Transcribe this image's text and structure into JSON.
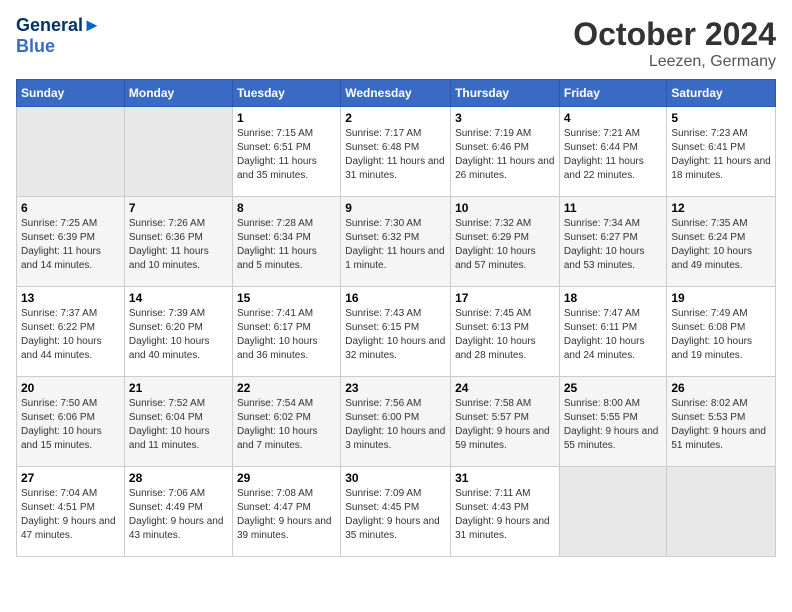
{
  "header": {
    "logo_line1": "General",
    "logo_line2": "Blue",
    "month_title": "October 2024",
    "subtitle": "Leezen, Germany"
  },
  "weekdays": [
    "Sunday",
    "Monday",
    "Tuesday",
    "Wednesday",
    "Thursday",
    "Friday",
    "Saturday"
  ],
  "weeks": [
    [
      {
        "day": "",
        "info": ""
      },
      {
        "day": "",
        "info": ""
      },
      {
        "day": "1",
        "info": "Sunrise: 7:15 AM\nSunset: 6:51 PM\nDaylight: 11 hours and 35 minutes."
      },
      {
        "day": "2",
        "info": "Sunrise: 7:17 AM\nSunset: 6:48 PM\nDaylight: 11 hours and 31 minutes."
      },
      {
        "day": "3",
        "info": "Sunrise: 7:19 AM\nSunset: 6:46 PM\nDaylight: 11 hours and 26 minutes."
      },
      {
        "day": "4",
        "info": "Sunrise: 7:21 AM\nSunset: 6:44 PM\nDaylight: 11 hours and 22 minutes."
      },
      {
        "day": "5",
        "info": "Sunrise: 7:23 AM\nSunset: 6:41 PM\nDaylight: 11 hours and 18 minutes."
      }
    ],
    [
      {
        "day": "6",
        "info": "Sunrise: 7:25 AM\nSunset: 6:39 PM\nDaylight: 11 hours and 14 minutes."
      },
      {
        "day": "7",
        "info": "Sunrise: 7:26 AM\nSunset: 6:36 PM\nDaylight: 11 hours and 10 minutes."
      },
      {
        "day": "8",
        "info": "Sunrise: 7:28 AM\nSunset: 6:34 PM\nDaylight: 11 hours and 5 minutes."
      },
      {
        "day": "9",
        "info": "Sunrise: 7:30 AM\nSunset: 6:32 PM\nDaylight: 11 hours and 1 minute."
      },
      {
        "day": "10",
        "info": "Sunrise: 7:32 AM\nSunset: 6:29 PM\nDaylight: 10 hours and 57 minutes."
      },
      {
        "day": "11",
        "info": "Sunrise: 7:34 AM\nSunset: 6:27 PM\nDaylight: 10 hours and 53 minutes."
      },
      {
        "day": "12",
        "info": "Sunrise: 7:35 AM\nSunset: 6:24 PM\nDaylight: 10 hours and 49 minutes."
      }
    ],
    [
      {
        "day": "13",
        "info": "Sunrise: 7:37 AM\nSunset: 6:22 PM\nDaylight: 10 hours and 44 minutes."
      },
      {
        "day": "14",
        "info": "Sunrise: 7:39 AM\nSunset: 6:20 PM\nDaylight: 10 hours and 40 minutes."
      },
      {
        "day": "15",
        "info": "Sunrise: 7:41 AM\nSunset: 6:17 PM\nDaylight: 10 hours and 36 minutes."
      },
      {
        "day": "16",
        "info": "Sunrise: 7:43 AM\nSunset: 6:15 PM\nDaylight: 10 hours and 32 minutes."
      },
      {
        "day": "17",
        "info": "Sunrise: 7:45 AM\nSunset: 6:13 PM\nDaylight: 10 hours and 28 minutes."
      },
      {
        "day": "18",
        "info": "Sunrise: 7:47 AM\nSunset: 6:11 PM\nDaylight: 10 hours and 24 minutes."
      },
      {
        "day": "19",
        "info": "Sunrise: 7:49 AM\nSunset: 6:08 PM\nDaylight: 10 hours and 19 minutes."
      }
    ],
    [
      {
        "day": "20",
        "info": "Sunrise: 7:50 AM\nSunset: 6:06 PM\nDaylight: 10 hours and 15 minutes."
      },
      {
        "day": "21",
        "info": "Sunrise: 7:52 AM\nSunset: 6:04 PM\nDaylight: 10 hours and 11 minutes."
      },
      {
        "day": "22",
        "info": "Sunrise: 7:54 AM\nSunset: 6:02 PM\nDaylight: 10 hours and 7 minutes."
      },
      {
        "day": "23",
        "info": "Sunrise: 7:56 AM\nSunset: 6:00 PM\nDaylight: 10 hours and 3 minutes."
      },
      {
        "day": "24",
        "info": "Sunrise: 7:58 AM\nSunset: 5:57 PM\nDaylight: 9 hours and 59 minutes."
      },
      {
        "day": "25",
        "info": "Sunrise: 8:00 AM\nSunset: 5:55 PM\nDaylight: 9 hours and 55 minutes."
      },
      {
        "day": "26",
        "info": "Sunrise: 8:02 AM\nSunset: 5:53 PM\nDaylight: 9 hours and 51 minutes."
      }
    ],
    [
      {
        "day": "27",
        "info": "Sunrise: 7:04 AM\nSunset: 4:51 PM\nDaylight: 9 hours and 47 minutes."
      },
      {
        "day": "28",
        "info": "Sunrise: 7:06 AM\nSunset: 4:49 PM\nDaylight: 9 hours and 43 minutes."
      },
      {
        "day": "29",
        "info": "Sunrise: 7:08 AM\nSunset: 4:47 PM\nDaylight: 9 hours and 39 minutes."
      },
      {
        "day": "30",
        "info": "Sunrise: 7:09 AM\nSunset: 4:45 PM\nDaylight: 9 hours and 35 minutes."
      },
      {
        "day": "31",
        "info": "Sunrise: 7:11 AM\nSunset: 4:43 PM\nDaylight: 9 hours and 31 minutes."
      },
      {
        "day": "",
        "info": ""
      },
      {
        "day": "",
        "info": ""
      }
    ]
  ]
}
